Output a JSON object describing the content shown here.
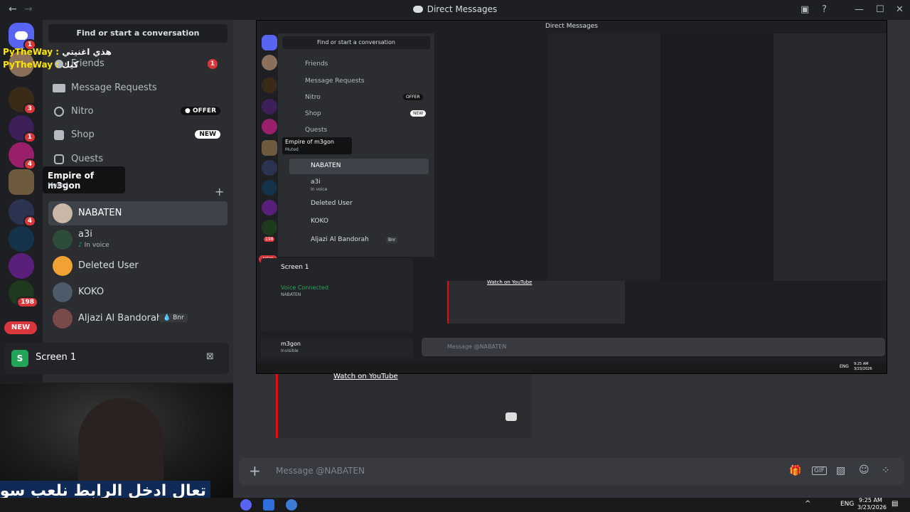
{
  "titlebar": {
    "title": "Direct Messages"
  },
  "search": {
    "placeholder": "Find or start a conversation"
  },
  "nav": {
    "friends": "Friends",
    "friends_count": "1",
    "message_requests": "Message Requests",
    "nitro": "Nitro",
    "nitro_pill": "OFFER",
    "shop": "Shop",
    "shop_pill": "NEW",
    "quests": "Quests"
  },
  "tooltip": {
    "name": "Empire of m3gon",
    "status": "Muted"
  },
  "guild_badges": [
    "1",
    "3",
    "1",
    "4",
    "4",
    "198"
  ],
  "guild_new": "NEW",
  "dms": [
    {
      "name": "NABATEN",
      "sub": ""
    },
    {
      "name": "a3i",
      "sub": "In voice"
    },
    {
      "name": "Deleted User",
      "sub": ""
    },
    {
      "name": "KOKO",
      "sub": ""
    },
    {
      "name": "Aljazi Al Bandorah",
      "sub": "",
      "tag": "Bnr"
    }
  ],
  "screenshare": {
    "label": "Screen 1"
  },
  "overlay_chat": [
    {
      "user": "PyTheWay :",
      "msg": "هذي اغنيتي"
    },
    {
      "user": "PyTheWay :",
      "msg": "كيك"
    }
  ],
  "caption": "تعال ادخل الرابط نلعب سو",
  "embed": {
    "link": "Watch on YouTube"
  },
  "message": {
    "placeholder": "Message @NABATEN"
  },
  "inner": {
    "title": "Direct Messages",
    "search": "Find or start a conversation",
    "friends": "Friends",
    "message_requests": "Message Requests",
    "nitro": "Nitro",
    "nitro_pill": "OFFER",
    "shop": "Shop",
    "shop_pill": "NEW",
    "quests": "Quests",
    "tooltip_name": "Empire of m3gon",
    "tooltip_status": "Muted",
    "dm1": "NABATEN",
    "dm2": "a3i",
    "dm2_sub": "In voice",
    "dm3": "Deleted User",
    "dm4": "KOKO",
    "dm5": "Aljazi Al Bandorah",
    "dm5_tag": "Bnr",
    "screen": "Screen 1",
    "voice": "Voice Connected",
    "voice_sub": "NABATEN",
    "user": "m3gon",
    "user_status": "Invisible",
    "message": "Message @NABATEN",
    "time": "9:25 AM",
    "date": "3/23/2026",
    "lang": "ENG",
    "badge_198": "198",
    "badge_new": "NEW"
  },
  "tray": {
    "lang": "ENG",
    "time": "9:25 AM",
    "date": "3/23/2026"
  },
  "colors": {
    "accent": "#5865f2",
    "bg": "#313338",
    "sidebar": "#2b2d31",
    "red": "#da373c",
    "green": "#23a559"
  }
}
